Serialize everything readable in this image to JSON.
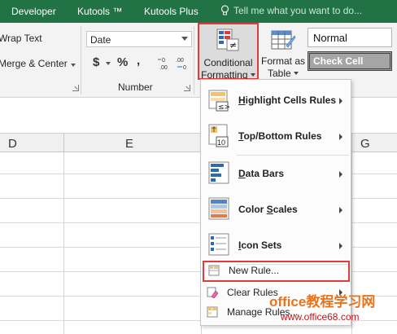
{
  "ribbon_tabs": [
    "Developer",
    "Kutools ™",
    "Kutools Plus"
  ],
  "tell_me": "Tell me what you want to do...",
  "alignment": {
    "wrap_text": "Wrap Text",
    "merge_center": "Merge & Center"
  },
  "number": {
    "format_value": "Date",
    "currency_symbol": "$",
    "percent_symbol": "%",
    "comma_symbol": ",",
    "increase_decimal": "←0\n.00",
    "decrease_decimal": ".00\n→0",
    "group_label": "Number"
  },
  "conditional_formatting": {
    "line1": "Conditional",
    "line2": "Formatting"
  },
  "format_as_table": {
    "line1": "Format as",
    "line2": "Table"
  },
  "cell_styles": {
    "normal": "Normal",
    "check_cell": "Check Cell"
  },
  "columns": [
    "D",
    "E",
    "G"
  ],
  "menu": {
    "items": [
      {
        "label_u": "H",
        "label_rest": "ighlight Cells Rules",
        "icon": "highlight-cells-icon"
      },
      {
        "label_u": "T",
        "label_rest": "op/Bottom Rules",
        "icon": "top-bottom-icon"
      },
      {
        "label_u": "D",
        "label_rest": "ata Bars",
        "icon": "data-bars-icon"
      },
      {
        "label_u": "S",
        "label_rest": "cales",
        "label_prefix": "Color ",
        "icon": "color-scales-icon"
      },
      {
        "label_u": "I",
        "label_rest": "con Sets",
        "icon": "icon-sets-icon"
      }
    ],
    "new_rule_u": "N",
    "new_rule_rest": "ew Rule...",
    "clear_rules_u": "C",
    "clear_rules_rest": "lear Rules",
    "manage_rules_prefix": "Manage ",
    "manage_rules_u": "R",
    "manage_rules_rest": "ules..."
  },
  "watermark": {
    "main": "office教程学习网",
    "url": "www.office68.com"
  },
  "colors": {
    "ribbon_green": "#217346",
    "highlight_red": "#e03a3a",
    "watermark_orange": "#e8741b",
    "watermark_red": "#c01818"
  }
}
